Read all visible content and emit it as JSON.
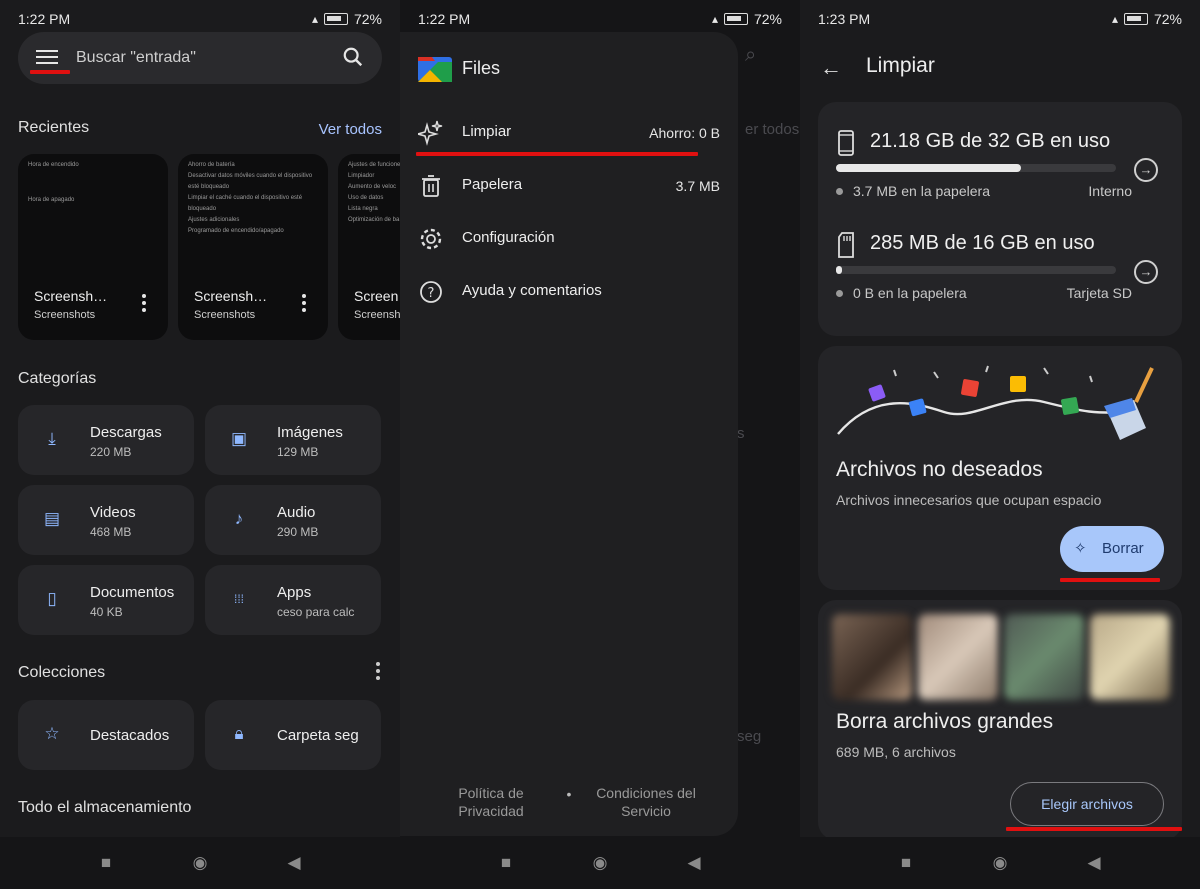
{
  "panel1": {
    "status": {
      "time": "1:22 PM",
      "battery": "72%"
    },
    "search": {
      "placeholder": "Buscar \"entrada\""
    },
    "recientes": {
      "title": "Recientes",
      "see_all": "Ver todos",
      "items": [
        {
          "name": "Screensh…",
          "folder": "Screenshots",
          "preview": [
            "Hora de encendido",
            "Hora de apagado"
          ]
        },
        {
          "name": "Screensh…",
          "folder": "Screenshots",
          "preview": [
            "Ahorro de batería",
            "Desactivar datos móviles cuando el dispositivo esté bloqueado",
            "Limpiar el caché cuando el dispositivo esté bloqueado",
            "Ajustes adicionales",
            "Programado de encendido/apagado"
          ]
        },
        {
          "name": "Screen",
          "folder": "Screensh",
          "preview": [
            "Ajustes de funciones",
            "Limpiador",
            "Aumento de veloc",
            "Uso de datos",
            "Lista negra",
            "Optimización de ba"
          ]
        }
      ]
    },
    "categorias": {
      "title": "Categorías",
      "items": [
        {
          "label": "Descargas",
          "value": "220 MB",
          "icon": "download-icon"
        },
        {
          "label": "Imágenes",
          "value": "129 MB",
          "icon": "image-icon"
        },
        {
          "label": "Videos",
          "value": "468 MB",
          "icon": "video-icon"
        },
        {
          "label": "Audio",
          "value": "290 MB",
          "icon": "music-note-icon"
        },
        {
          "label": "Documentos",
          "value": "40 KB",
          "icon": "document-icon"
        },
        {
          "label": "Apps",
          "value": "ceso para calc",
          "icon": "apps-grid-icon"
        }
      ]
    },
    "colecciones": {
      "title": "Colecciones",
      "items": [
        {
          "label": "Destacados",
          "icon": "star-icon"
        },
        {
          "label": "Carpeta seg",
          "icon": "lock-icon"
        }
      ]
    },
    "almacenamiento": {
      "title": "Todo el almacenamiento"
    }
  },
  "panel2": {
    "status": {
      "time": "1:22 PM",
      "battery": "72%"
    },
    "drawer": {
      "app_title": "Files",
      "items": [
        {
          "label": "Limpiar",
          "value": "Ahorro: 0 B",
          "icon": "sparkle-icon"
        },
        {
          "label": "Papelera",
          "value": "3.7 MB",
          "icon": "trash-icon"
        },
        {
          "label": "Configuración",
          "value": "",
          "icon": "gear-icon"
        },
        {
          "label": "Ayuda y comentarios",
          "value": "",
          "icon": "help-icon"
        }
      ],
      "footer": {
        "privacy": "Política de Privacidad",
        "separator": "•",
        "terms": "Condiciones del Servicio"
      }
    },
    "background": {
      "see_all": "er todos",
      "fragment_s": "s",
      "fragment_seg": "seg"
    }
  },
  "panel3": {
    "status": {
      "time": "1:23 PM",
      "battery": "72%"
    },
    "title": "Limpiar",
    "storage": [
      {
        "usage": "21.18 GB de 32 GB en uso",
        "trash": "3.7 MB en la papelera",
        "kind": "Interno",
        "used_fraction": 0.66,
        "icon": "phone-icon"
      },
      {
        "usage": "285 MB de 16 GB en uso",
        "trash": "0 B en la papelera",
        "kind": "Tarjeta SD",
        "used_fraction": 0.02,
        "icon": "sd-card-icon"
      }
    ],
    "junk": {
      "title": "Archivos no deseados",
      "desc": "Archivos innecesarios que ocupan espacio",
      "button": "Borrar"
    },
    "large": {
      "title": "Borra archivos grandes",
      "desc": "689 MB, 6 archivos",
      "button": "Elegir archivos"
    }
  },
  "nav": {
    "recents": "■",
    "home": "◉",
    "back": "◀"
  }
}
